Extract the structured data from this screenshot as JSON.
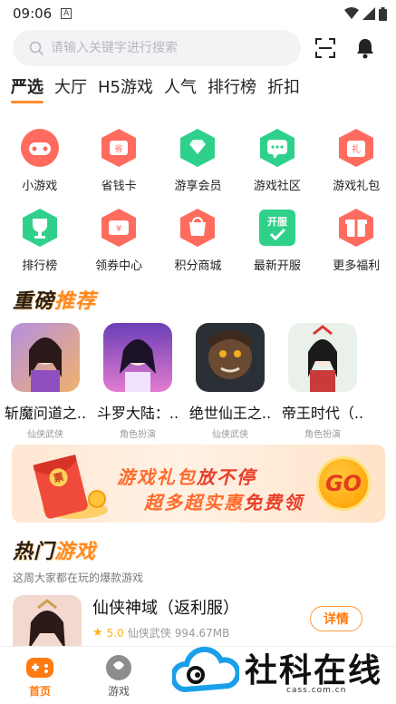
{
  "status_bar": {
    "time": "09:06",
    "notification": "A"
  },
  "search": {
    "placeholder": "请输入关键字进行搜索"
  },
  "tabs": [
    {
      "label": "严选",
      "active": true
    },
    {
      "label": "大厅"
    },
    {
      "label": "H5游戏"
    },
    {
      "label": "人气"
    },
    {
      "label": "排行榜"
    },
    {
      "label": "折扣"
    }
  ],
  "grid": [
    {
      "label": "小游戏",
      "icon": "gamepad-icon"
    },
    {
      "label": "省钱卡",
      "icon": "saving-card-icon"
    },
    {
      "label": "游享会员",
      "icon": "diamond-icon"
    },
    {
      "label": "游戏社区",
      "icon": "chat-bubble-icon"
    },
    {
      "label": "游戏礼包",
      "icon": "gift-bag-icon"
    },
    {
      "label": "排行榜",
      "icon": "trophy-icon"
    },
    {
      "label": "领券中心",
      "icon": "coupon-icon"
    },
    {
      "label": "积分商城",
      "icon": "points-shop-icon"
    },
    {
      "label": "最新开服",
      "icon": "new-server-icon"
    },
    {
      "label": "更多福利",
      "icon": "gift-box-icon"
    }
  ],
  "recommend": {
    "title_a": "重磅",
    "title_b": "推荐",
    "items": [
      {
        "name": "斩魔问道之..",
        "tag": "仙侠武侠"
      },
      {
        "name": "斗罗大陆：..",
        "tag": "角色扮演"
      },
      {
        "name": "绝世仙王之..",
        "tag": "仙侠武侠"
      },
      {
        "name": "帝王时代（..",
        "tag": "角色扮演"
      }
    ]
  },
  "banner": {
    "line1_a": "游戏礼包",
    "line1_b": "放不停",
    "line2_a": "超多超实惠",
    "line2_b": "免费领",
    "go": "GO",
    "envelope_char": "票"
  },
  "hot": {
    "title_a": "热门",
    "title_b": "游戏",
    "subtitle": "这周大家都在玩的爆款游戏",
    "game": {
      "name": "仙侠神域（返利服）",
      "rating": "5.0",
      "category": "仙侠武侠",
      "size": "994.67MB",
      "button": "详情"
    }
  },
  "bottom_nav": [
    {
      "label": "首页",
      "active": true
    },
    {
      "label": "游戏"
    }
  ],
  "watermark": {
    "text": "社科在线",
    "url": "cass.com.cn"
  },
  "colors": {
    "accent": "#ff8a2b",
    "grid_red": "#ff6b5e",
    "grid_green": "#2fd18a"
  }
}
